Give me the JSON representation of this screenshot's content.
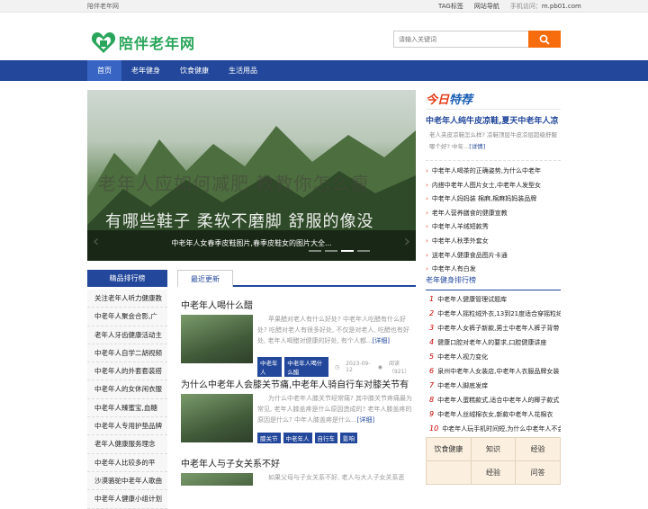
{
  "topbar": {
    "site": "陪伴老年网",
    "tag": "TAG标签",
    "nav": "网站导航",
    "mobile_label": "手机访问：",
    "mobile_url": "m.pb01.com"
  },
  "logo": {
    "name": "陪伴老年网",
    "color": "#2aa55b"
  },
  "search": {
    "placeholder": "请输入关键词",
    "icon": "search-icon"
  },
  "nav": {
    "items": [
      "首页",
      "老年健身",
      "饮食健康",
      "生活用品"
    ],
    "active": 0
  },
  "banner": {
    "overlay1": "老年人应如何减肥 教教你怎么瘦",
    "overlay2": "有哪些鞋子 柔软不磨脚 舒服的像没",
    "caption": "中老年人女春季皮鞋图片,春季皮鞋女的图片大全...",
    "slides": 4,
    "active_slide": 2
  },
  "today": {
    "title_a": "今日",
    "title_b": "特荐",
    "headline": "中老年人纯牛皮凉鞋,夏天中老年人凉",
    "desc": "老人夹皮凉鞋怎么样? 凉鞋顶层牛皮凉层超级舒服哪个好? 中年...",
    "desc_link": "[详情]",
    "items": [
      "中老年人喝茶的正确姿势,为什么中老年",
      "内搭中老年人图片女士,中老年人发型女",
      "中老年人妈妈装 棉麻,棉麻妈妈装品牌",
      "老年人营养膳食的健康宣教",
      "中老年人羊绒短款秀",
      "中老年人秋季外套女",
      "送老年人健康食品图片卡通",
      "中老年人有白发"
    ]
  },
  "rank": {
    "title": "老年健身排行榜",
    "items": [
      "中老年人健康管理试题库",
      "中老年人摇粒绒外衣,13到21度适合穿摇粒绒",
      "中老年人女裤子新款,男士中老年人裤子背带",
      "健康口腔对老年人的要求,口腔健康讲座",
      "中老年人视力变化",
      "泉州中老年人女装店,中老年人衣服品牌女装",
      "中老年人脚底发痒",
      "中老年人蛋糕款式,适合中老年人的椰子款式",
      "中老年人丝绒棉衣女,新款中老年人花棉衣",
      "中老年人玩手机时间短,为什么中老年人不会"
    ]
  },
  "grid": [
    "饮食健康",
    "知识",
    "经验",
    "",
    "经验",
    "问答"
  ],
  "side": {
    "title": "精品排行榜",
    "items": [
      "关注老年人听力健康教",
      "中老年人聚会合影,广",
      "老年人牙齿健康活动主",
      "中老年人自学二胡视频",
      "中老年人的外套套装搭",
      "中老年人的女休闲衣服",
      "中老年人臻蜜宝,血糖",
      "中老年人专用护垫品牌",
      "老年人健康服务理念",
      "中老年人比较多的平",
      "沙漠骆驼中老年人歌曲",
      "中老年人健康小组计划"
    ]
  },
  "latest": {
    "tab": "最近更新",
    "articles": [
      {
        "title": "中老年人喝什么醋",
        "excerpt": "苹果醋对老人有什么好处? 中老年人吃醋有什么好处? 吃醋对老人有很多好处, 不仅是对老人, 吃醋也有好处, 老年人喝醋对健康的好处, 有个人都...",
        "link": "[详细]",
        "tags": [
          "中老年人",
          "中老年人喝什么醋"
        ],
        "date": "2023-09-12",
        "views": "阅读（921）"
      },
      {
        "title": "为什么中老年人会膝关节痛,中老年人骑自行车对膝关节有",
        "excerpt": "为什么中老年人膝关节经常痛? 其中膝关节疼痛最为常见, 老年人膝盖疼是什么原因造成的? 老年人膝盖疼的原因是什么? 中年人膝盖疼是什么...",
        "link": "[详细]",
        "tags": [
          "膝关节",
          "中老年人",
          "自行车",
          "影响"
        ]
      },
      {
        "title": "中老年人与子女关系不好",
        "excerpt": "如果父母与子女关系不好, 老人与大人子女关系恶",
        "link": ""
      }
    ]
  }
}
